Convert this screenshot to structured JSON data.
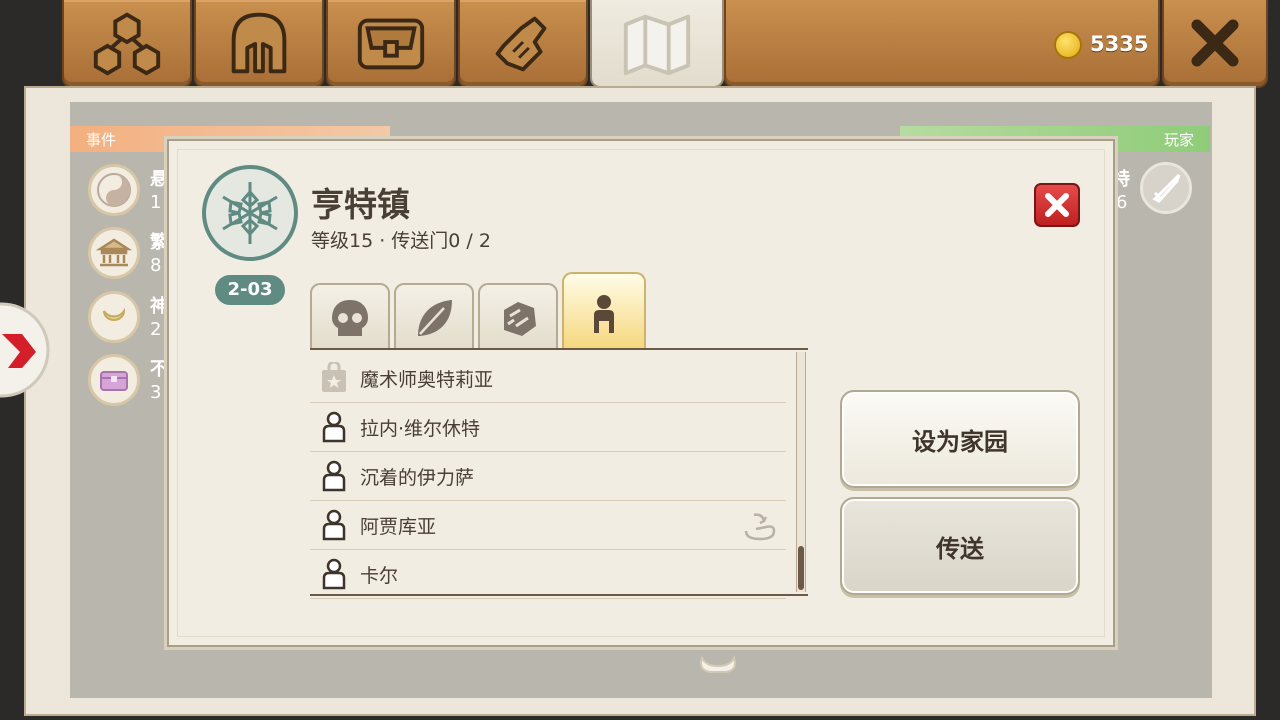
{
  "currency": {
    "amount": "5335",
    "icon": "gold-coin-icon",
    "color": "#f2c12e"
  },
  "top_tabs": [
    {
      "name": "hierarchy-tab",
      "icon": "hierarchy-icon"
    },
    {
      "name": "helmet-tab",
      "icon": "helmet-icon"
    },
    {
      "name": "chest-tab",
      "icon": "chest-icon"
    },
    {
      "name": "fist-tab",
      "icon": "fist-icon"
    },
    {
      "name": "map-tab",
      "icon": "map-icon",
      "active": true
    }
  ],
  "left_panel": {
    "header": "事件",
    "items": [
      {
        "icon": "yin-yang-icon",
        "title": "悬",
        "value": "1"
      },
      {
        "icon": "temple-icon",
        "title": "繁",
        "value": "8"
      },
      {
        "icon": "moon-icon",
        "title": "神",
        "value": "2"
      },
      {
        "icon": "treasure-chest-icon",
        "title": "不",
        "value": "3"
      }
    ]
  },
  "right_panel": {
    "header": "玩家",
    "item": {
      "icon": "sword-icon",
      "title": "特",
      "value": "6"
    }
  },
  "town": {
    "name": "亨特镇",
    "subtitle": "等级15 · 传送门0 / 2",
    "code": "2-03",
    "emblem_icon": "snowflake-emblem-icon"
  },
  "category_tabs": [
    {
      "icon": "skull-icon"
    },
    {
      "icon": "leaf-icon"
    },
    {
      "icon": "ore-icon"
    },
    {
      "icon": "person-icon",
      "active": true
    }
  ],
  "npc_list": [
    {
      "name": "魔术师奥特莉亚",
      "icon": "shop-bag-icon"
    },
    {
      "name": "拉内·维尔休特",
      "icon": "person-outline-icon"
    },
    {
      "name": "沉着的伊力萨",
      "icon": "person-outline-icon"
    },
    {
      "name": "阿贾库亚",
      "icon": "person-outline-icon",
      "extra_icon": "hand-receive-icon"
    },
    {
      "name": "卡尔",
      "icon": "person-outline-icon"
    }
  ],
  "buttons": {
    "set_home": "设为家园",
    "teleport": "传送"
  },
  "colors": {
    "accent_teal": "#5f8b83",
    "close_red": "#d63a3a",
    "wood": "#b97c40"
  }
}
